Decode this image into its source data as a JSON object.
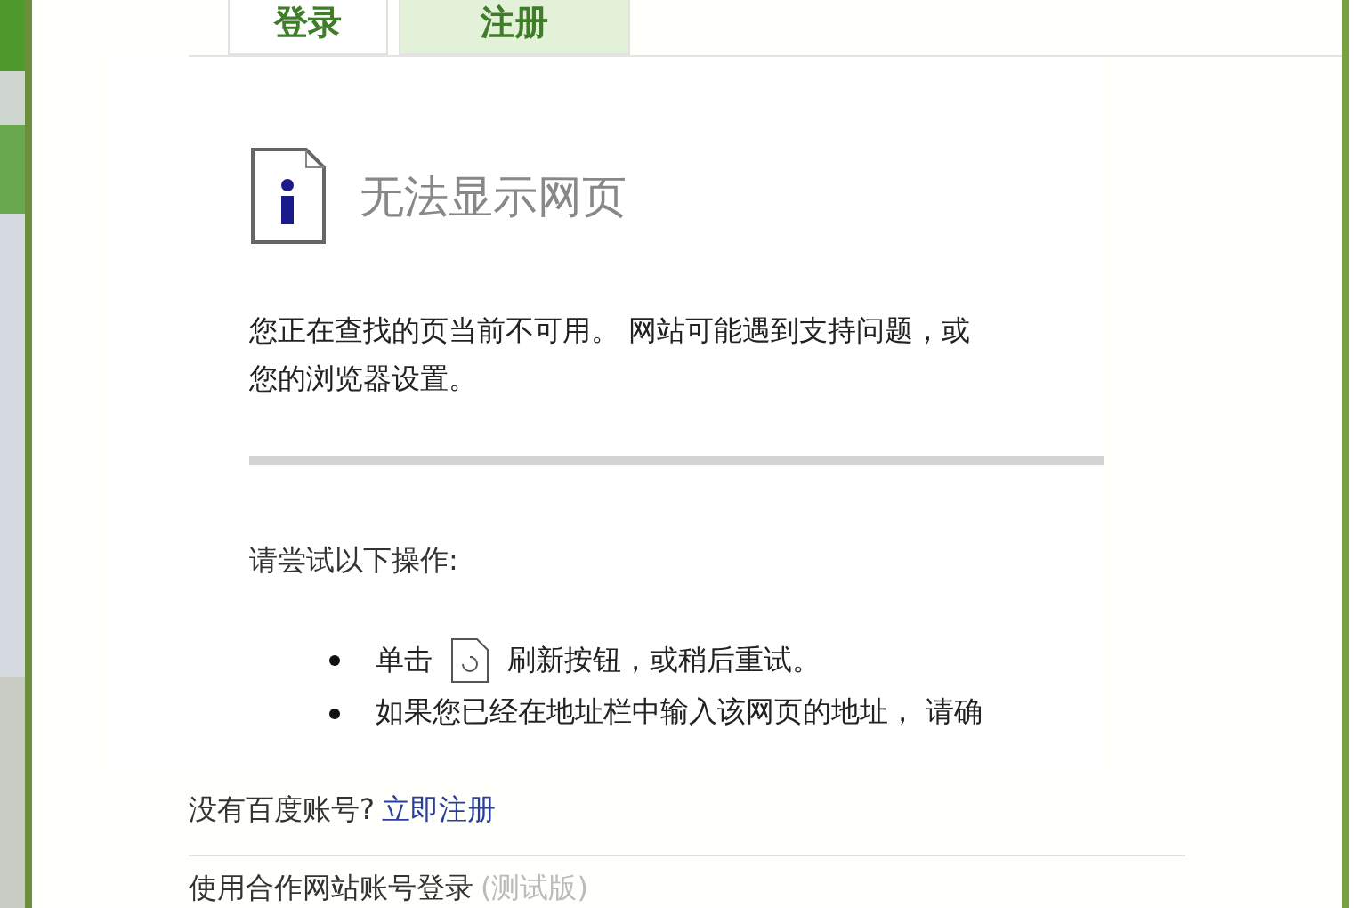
{
  "tabs": [
    {
      "label": "登录",
      "selected": true
    },
    {
      "label": "注册",
      "selected": false
    }
  ],
  "error_page": {
    "title": "无法显示网页",
    "message_lines": [
      "您正在查找的页当前不可用。 网站可能遇到支持问题，或",
      "您的浏览器设置。"
    ],
    "prompt": "请尝试以下操作:",
    "bullets": [
      {
        "kind": "refresh",
        "before": "单击",
        "after": "刷新按钮，或稍后重试。"
      },
      {
        "kind": "text",
        "text": "如果您已经在地址栏中输入该网页的地址， 请确"
      }
    ]
  },
  "register": {
    "question": "没有百度账号?",
    "link": "立即注册"
  },
  "partner_login": {
    "text": "使用合作网站账号登录",
    "note": "(测试版)"
  }
}
